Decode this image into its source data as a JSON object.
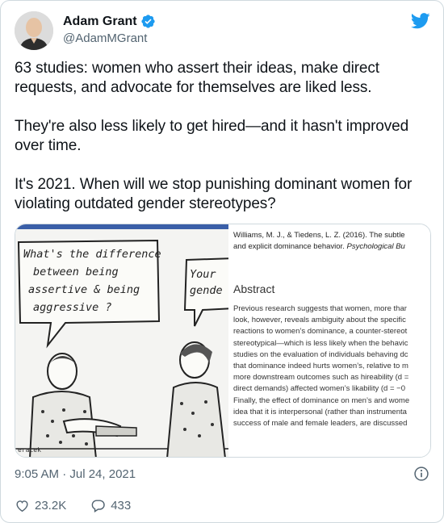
{
  "author": {
    "name": "Adam Grant",
    "handle": "@AdamMGrant"
  },
  "tweet": {
    "paragraphs": [
      "63 studies: women who assert their ideas, make direct requests, and advocate for themselves are liked less.",
      "They're also less likely to get hired—and it hasn't improved over time.",
      "It's 2021. When will we stop punishing dominant women for violating outdated gender stereotypes?"
    ],
    "timestamp": "9:05 AM · Jul 24, 2021"
  },
  "media": {
    "cartoon": {
      "bubble_left_lines": [
        "What's the difference",
        "between being",
        "assertive & being",
        "aggressive ?"
      ],
      "bubble_right_lines": [
        "Your",
        "gende"
      ],
      "signature": "eracek"
    },
    "paper": {
      "citation_line1": "Williams, M. J., & Tiedens, L. Z. (2016). The subtle",
      "citation_line2_prefix": "and explicit dominance behavior. ",
      "citation_line2_journal": "Psychological Bu",
      "abstract_title": "Abstract",
      "abstract_lines": [
        "Previous research suggests that women, more thar",
        "look, however, reveals ambiguity about the specific",
        "reactions to women’s dominance, a counter-stereot",
        "stereotypical—which is less likely when the behavic",
        "studies on the evaluation of individuals behaving dc",
        "that dominance indeed hurts women’s, relative to m",
        "more downstream outcomes such as hireability (d =",
        "direct demands) affected women’s likability (d = −0",
        "Finally, the effect of dominance on men’s and wome",
        "idea that it is interpersonal (rather than instrumenta",
        "success of male and female leaders, are discussed"
      ]
    }
  },
  "actions": {
    "likes": "23.2K",
    "replies": "433"
  },
  "colors": {
    "brand_blue": "#1d9bf0",
    "secondary_text": "#536471",
    "border": "#cfd9de"
  },
  "icons": [
    "verified-badge-icon",
    "twitter-bird-icon",
    "info-icon",
    "heart-icon",
    "reply-bubble-icon"
  ]
}
